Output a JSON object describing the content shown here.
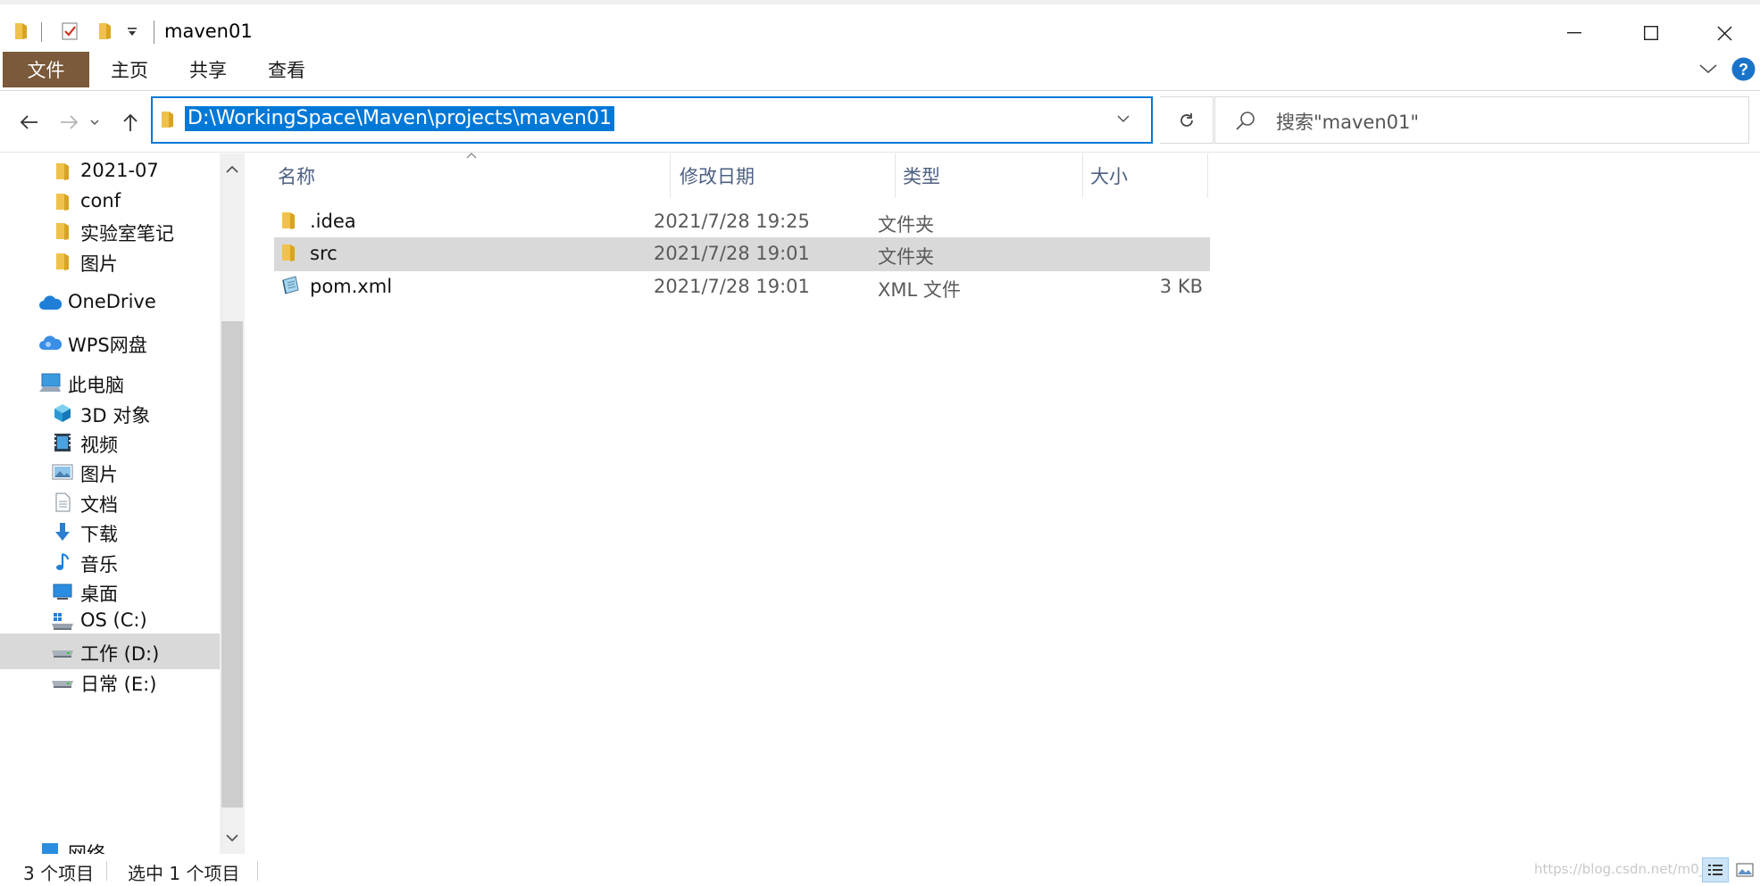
{
  "window": {
    "title": "maven01",
    "qa_icons": [
      "folder-icon",
      "properties-check-icon",
      "new-folder-icon",
      "customize-dropdown-icon"
    ]
  },
  "ribbon": {
    "tabs": [
      {
        "label": "文件",
        "active": true
      },
      {
        "label": "主页"
      },
      {
        "label": "共享"
      },
      {
        "label": "查看"
      }
    ]
  },
  "address": {
    "path": "D:\\WorkingSpace\\Maven\\projects\\maven01",
    "search_placeholder": "搜索\"maven01\""
  },
  "sidebar": {
    "items": [
      {
        "label": "2021-07",
        "icon": "folder-icon",
        "indent": 1
      },
      {
        "label": "conf",
        "icon": "folder-icon",
        "indent": 1
      },
      {
        "label": "实验室笔记",
        "icon": "folder-icon",
        "indent": 1
      },
      {
        "label": "图片",
        "icon": "folder-icon",
        "indent": 1
      },
      {
        "label": "OneDrive",
        "icon": "onedrive-cloud-icon",
        "indent": 0
      },
      {
        "label": "WPS网盘",
        "icon": "wps-cloud-icon",
        "indent": 0
      },
      {
        "label": "此电脑",
        "icon": "this-pc-icon",
        "indent": 0
      },
      {
        "label": "3D 对象",
        "icon": "3d-objects-icon",
        "indent": 1
      },
      {
        "label": "视频",
        "icon": "videos-icon",
        "indent": 1
      },
      {
        "label": "图片",
        "icon": "pictures-icon",
        "indent": 1
      },
      {
        "label": "文档",
        "icon": "documents-icon",
        "indent": 1
      },
      {
        "label": "下载",
        "icon": "downloads-icon",
        "indent": 1
      },
      {
        "label": "音乐",
        "icon": "music-icon",
        "indent": 1
      },
      {
        "label": "桌面",
        "icon": "desktop-icon",
        "indent": 1
      },
      {
        "label": "OS (C:)",
        "icon": "os-drive-icon",
        "indent": 1
      },
      {
        "label": "工作 (D:)",
        "icon": "drive-icon",
        "indent": 1,
        "selected": true
      },
      {
        "label": "日常 (E:)",
        "icon": "drive-icon",
        "indent": 1
      },
      {
        "label": "网络",
        "icon": "network-icon",
        "indent": 0
      }
    ]
  },
  "columns": {
    "name": "名称",
    "date": "修改日期",
    "type": "类型",
    "size": "大小"
  },
  "files": [
    {
      "name": ".idea",
      "date": "2021/7/28 19:25",
      "type": "文件夹",
      "size": "",
      "icon": "folder-icon"
    },
    {
      "name": "src",
      "date": "2021/7/28 19:01",
      "type": "文件夹",
      "size": "",
      "icon": "folder-icon",
      "selected": true
    },
    {
      "name": "pom.xml",
      "date": "2021/7/28 19:01",
      "type": "XML 文件",
      "size": "3 KB",
      "icon": "xml-file-icon"
    }
  ],
  "status": {
    "item_count": "3 个项目",
    "selection": "选中 1 个项目",
    "watermark": "https://blog.csdn.net/m0_"
  },
  "colors": {
    "accent": "#0078d7",
    "file_tab": "#7a5a3a",
    "selection": "#d9d9d9",
    "folder": "#f0c24b"
  }
}
